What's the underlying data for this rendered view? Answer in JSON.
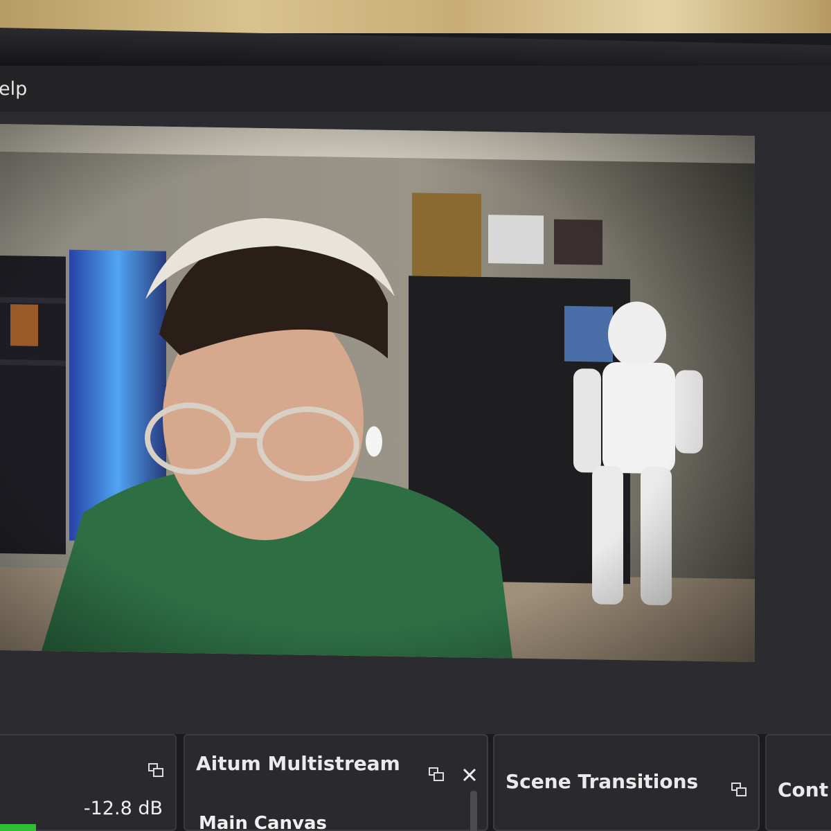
{
  "menubar": {
    "help_label": "elp"
  },
  "video_preview": {
    "camera_description_none": ""
  },
  "docks": {
    "audio_mixer": {
      "level": "-12.8 dB"
    },
    "aitum": {
      "title": "Aitum Multistream",
      "sub_label": "Main Canvas"
    },
    "scene_transitions": {
      "title": "Scene Transitions"
    },
    "controls": {
      "title": "Cont"
    }
  },
  "colors": {
    "dock_bg": "#2a2a2e",
    "meter_green": "#2fbf37",
    "menubar_bg": "#242427"
  },
  "icons": [
    "float-icon",
    "close-icon"
  ]
}
